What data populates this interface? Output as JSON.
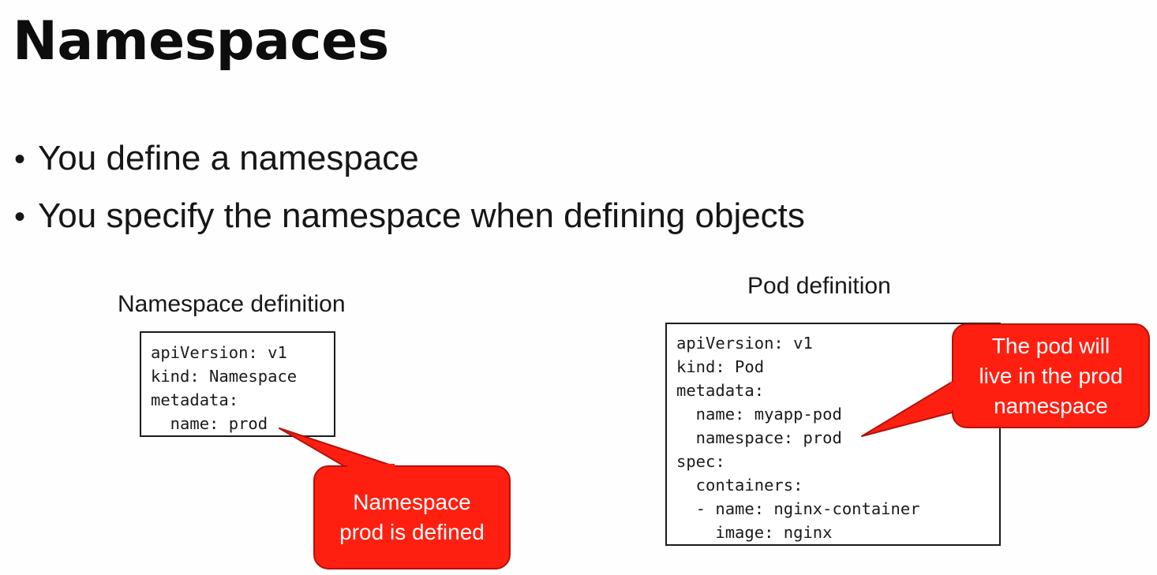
{
  "slide": {
    "title": "Namespaces",
    "bullets": [
      "You define a namespace",
      "You specify the namespace when defining objects"
    ],
    "bullet_glyph": "•"
  },
  "namespace_definition": {
    "caption": "Namespace definition",
    "code_lines": [
      "apiVersion: v1",
      "kind: Namespace",
      "metadata:",
      "  name: prod"
    ],
    "callout_lines": [
      "Namespace",
      "prod is defined"
    ]
  },
  "pod_definition": {
    "caption": "Pod definition",
    "code_lines": [
      "apiVersion: v1",
      "kind: Pod",
      "metadata:",
      "  name: myapp-pod",
      "  namespace: prod",
      "spec:",
      "  containers:",
      "  - name: nginx-container",
      "    image: nginx"
    ],
    "callout_lines": [
      "The pod will",
      "live in the prod",
      "namespace"
    ]
  },
  "colors": {
    "callout_fill": "#ff1f10",
    "callout_stroke": "#b3120a",
    "callout_text": "#ffffff",
    "box_border": "#1a1a1a"
  }
}
